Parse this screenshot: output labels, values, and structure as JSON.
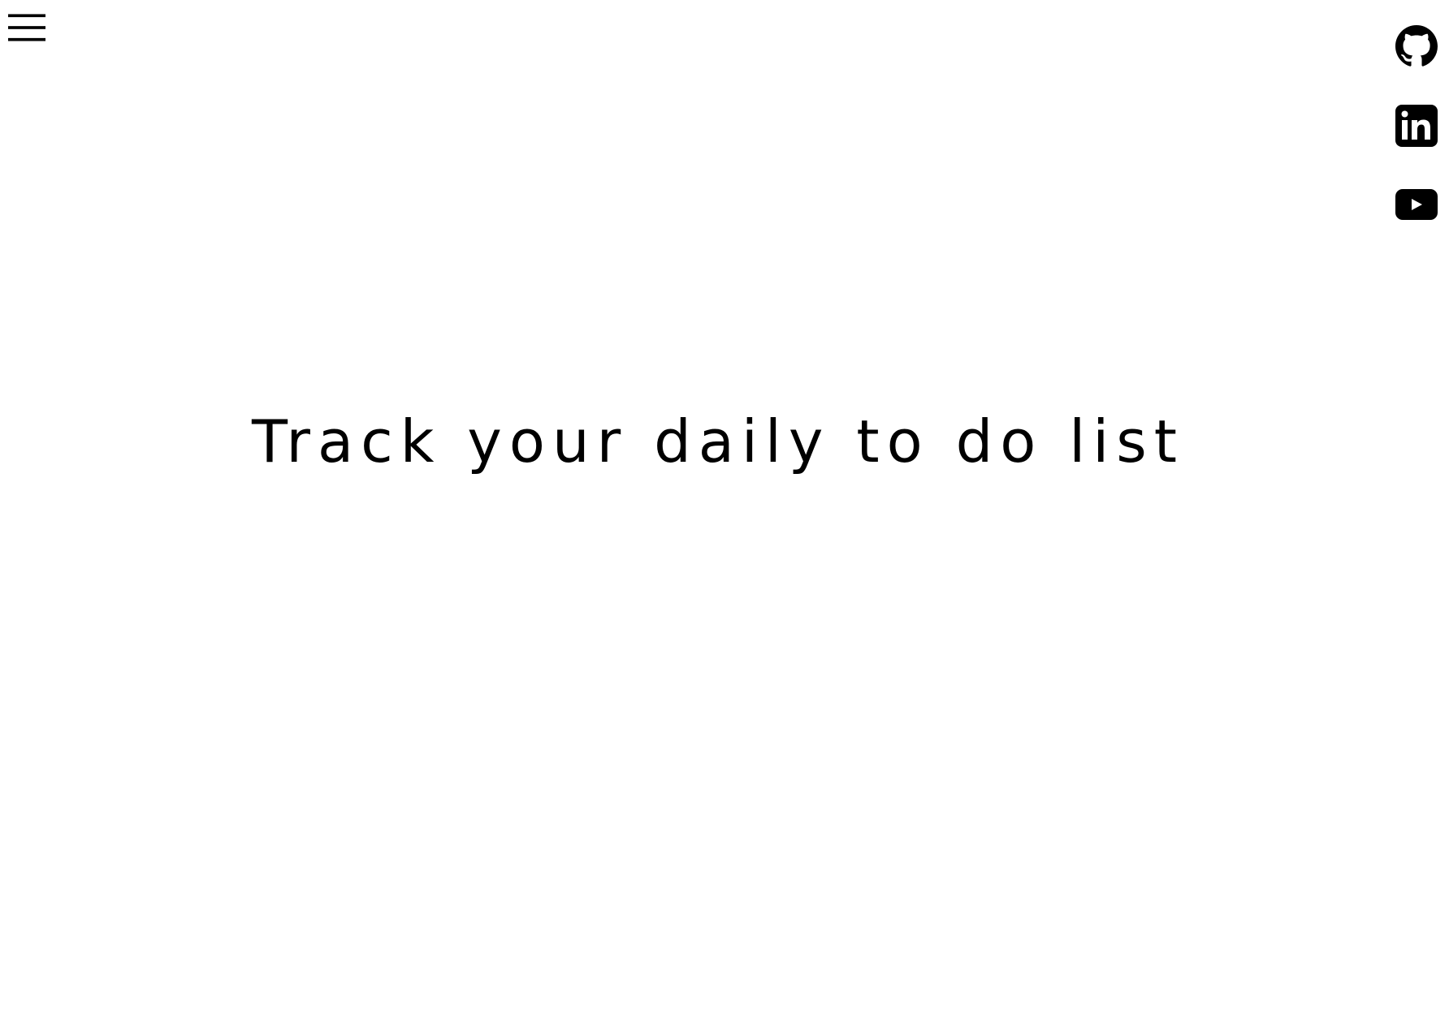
{
  "header": {
    "menu_icon": "hamburger-menu-icon"
  },
  "social_links": [
    {
      "name": "GitHub",
      "icon": "github-icon"
    },
    {
      "name": "LinkedIn",
      "icon": "linkedin-icon"
    },
    {
      "name": "YouTube",
      "icon": "youtube-icon"
    }
  ],
  "hero": {
    "title": "Track your daily to do list"
  },
  "colors": {
    "background": "#ffffff",
    "foreground": "#000000"
  }
}
